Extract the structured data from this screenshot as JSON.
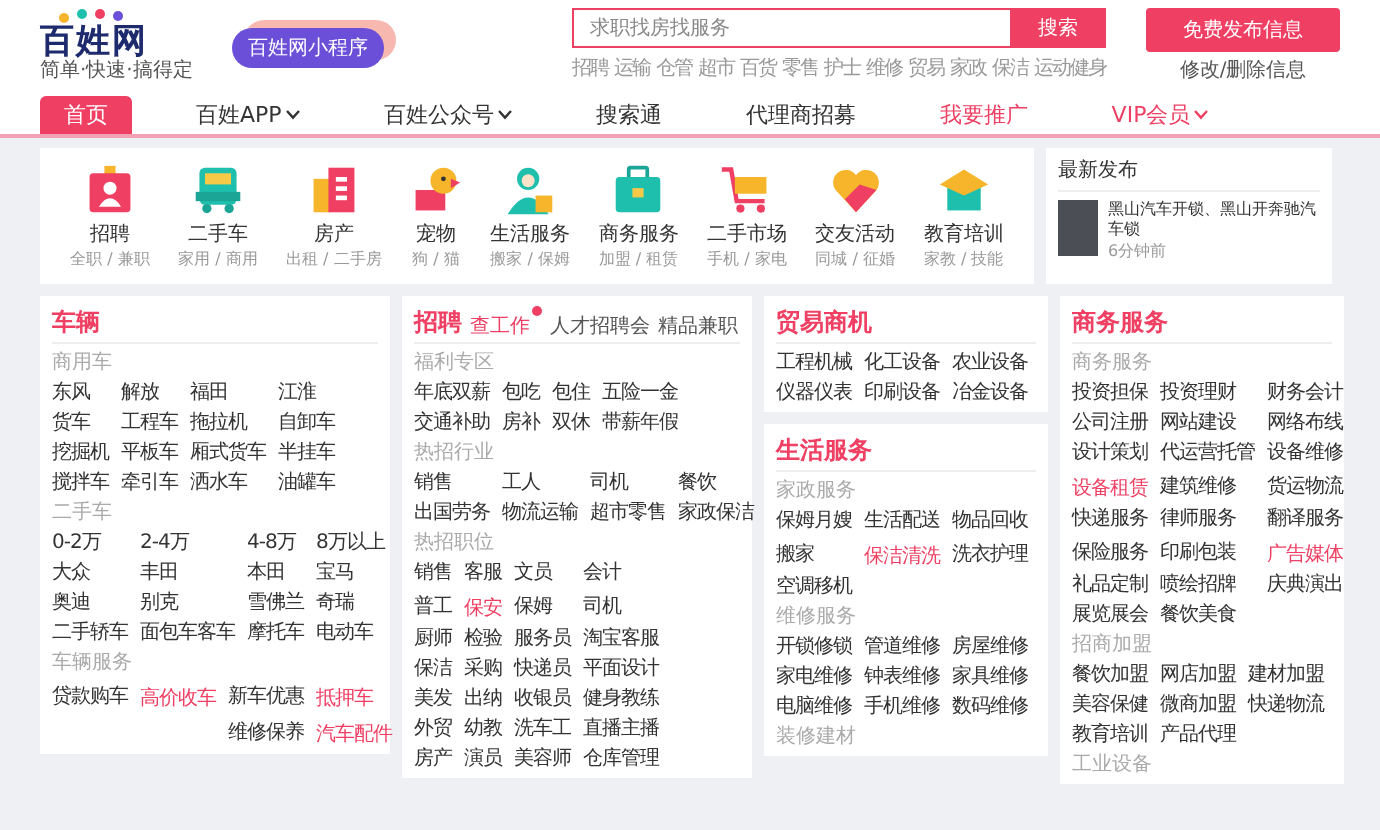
{
  "header": {
    "logo": {
      "name": "百姓网",
      "slogan": "简单·快速·搞得定"
    },
    "mini_program": "百姓网小程序",
    "search": {
      "placeholder": "求职找房找服务",
      "button": "搜索"
    },
    "hot_links": [
      "招聘",
      "运输",
      "仓管",
      "超市",
      "百货",
      "零售",
      "护士",
      "维修",
      "贸易",
      "家政",
      "保洁",
      "运动健身"
    ],
    "publish_button": "免费发布信息",
    "manage_link": "修改/删除信息"
  },
  "nav": [
    {
      "label": "首页",
      "selected": true,
      "dropdown": false,
      "highlight": false
    },
    {
      "label": "百姓APP",
      "selected": false,
      "dropdown": true,
      "highlight": false
    },
    {
      "label": "百姓公众号",
      "selected": false,
      "dropdown": true,
      "highlight": false
    },
    {
      "label": "搜索通",
      "selected": false,
      "dropdown": false,
      "highlight": false
    },
    {
      "label": "代理商招募",
      "selected": false,
      "dropdown": false,
      "highlight": false
    },
    {
      "label": "我要推广",
      "selected": false,
      "dropdown": false,
      "highlight": true
    },
    {
      "label": "VIP会员",
      "selected": false,
      "dropdown": true,
      "highlight": true
    }
  ],
  "categories": [
    {
      "kind": "badge",
      "label": "招聘",
      "sub": "全职 / 兼职"
    },
    {
      "kind": "car",
      "label": "二手车",
      "sub": "家用 / 商用"
    },
    {
      "kind": "building",
      "label": "房产",
      "sub": "出租 / 二手房"
    },
    {
      "kind": "dog",
      "label": "宠物",
      "sub": "狗 / 猫"
    },
    {
      "kind": "person",
      "label": "生活服务",
      "sub": "搬家 / 保姆"
    },
    {
      "kind": "briefcase",
      "label": "商务服务",
      "sub": "加盟 / 租赁"
    },
    {
      "kind": "cart",
      "label": "二手市场",
      "sub": "手机 / 家电"
    },
    {
      "kind": "heart",
      "label": "交友活动",
      "sub": "同城 / 征婚"
    },
    {
      "kind": "cap",
      "label": "教育培训",
      "sub": "家教 / 技能"
    }
  ],
  "latest": {
    "title": "最新发布",
    "items": [
      {
        "text": "黑山汽车开锁、黑山开奔驰汽车锁",
        "time": "6分钟前"
      }
    ]
  },
  "columns": [
    [
      {
        "title": "车辆",
        "sections": [
          {
            "label": "商用车",
            "rows": [
              [
                {
                  "text": "东风",
                  "hot": false
                },
                {
                  "text": "解放",
                  "hot": false
                },
                {
                  "text": "福田",
                  "hot": false
                },
                {
                  "text": "江淮",
                  "hot": false
                }
              ],
              [
                {
                  "text": "货车",
                  "hot": false
                },
                {
                  "text": "工程车",
                  "hot": false
                },
                {
                  "text": "拖拉机",
                  "hot": false
                },
                {
                  "text": "自卸车",
                  "hot": false
                }
              ],
              [
                {
                  "text": "挖掘机",
                  "hot": false
                },
                {
                  "text": "平板车",
                  "hot": false
                },
                {
                  "text": "厢式货车",
                  "hot": false
                },
                {
                  "text": "半挂车",
                  "hot": false
                }
              ],
              [
                {
                  "text": "搅拌车",
                  "hot": false
                },
                {
                  "text": "牵引车",
                  "hot": false
                },
                {
                  "text": "洒水车",
                  "hot": false
                },
                {
                  "text": "油罐车",
                  "hot": false
                }
              ]
            ]
          },
          {
            "label": "二手车",
            "rows": [
              [
                {
                  "text": "0-2万",
                  "hot": false
                },
                {
                  "text": "2-4万",
                  "hot": false
                },
                {
                  "text": "4-8万",
                  "hot": false
                },
                {
                  "text": "8万以上",
                  "hot": false
                }
              ],
              [
                {
                  "text": "大众",
                  "hot": false
                },
                {
                  "text": "丰田",
                  "hot": false
                },
                {
                  "text": "本田",
                  "hot": false
                },
                {
                  "text": "宝马",
                  "hot": false
                }
              ],
              [
                {
                  "text": "奥迪",
                  "hot": false
                },
                {
                  "text": "别克",
                  "hot": false
                },
                {
                  "text": "雪佛兰",
                  "hot": false
                },
                {
                  "text": "奇瑞",
                  "hot": false
                }
              ],
              [
                {
                  "text": "二手轿车",
                  "hot": false
                },
                {
                  "text": "面包车客车",
                  "hot": false
                },
                {
                  "text": "摩托车",
                  "hot": false
                },
                {
                  "text": "电动车",
                  "hot": false
                }
              ]
            ]
          },
          {
            "label": "车辆服务",
            "rows": [
              [
                {
                  "text": "贷款购车",
                  "hot": false
                },
                {
                  "text": "高价收车",
                  "hot": true
                },
                {
                  "text": "新车优惠",
                  "hot": false
                },
                {
                  "text": "抵押车",
                  "hot": true
                }
              ],
              [
                null,
                null,
                {
                  "text": "维修保养",
                  "hot": false
                },
                {
                  "text": "汽车配件",
                  "hot": true
                }
              ]
            ]
          }
        ]
      }
    ],
    [
      {
        "title": "招聘",
        "links": [
          {
            "text": "查工作",
            "highlight": true,
            "badge": true
          },
          {
            "text": "人才招聘会",
            "highlight": false,
            "badge": false
          },
          {
            "text": "精品兼职",
            "highlight": false,
            "badge": false
          }
        ],
        "sections": [
          {
            "label": "福利专区",
            "rows": [
              [
                {
                  "text": "年底双薪",
                  "hot": false
                },
                {
                  "text": "包吃",
                  "hot": false
                },
                {
                  "text": "包住",
                  "hot": false
                },
                {
                  "text": "五险一金",
                  "hot": false
                }
              ],
              [
                {
                  "text": "交通补助",
                  "hot": false
                },
                {
                  "text": "房补",
                  "hot": false
                },
                {
                  "text": "双休",
                  "hot": false
                },
                {
                  "text": "带薪年假",
                  "hot": false
                }
              ]
            ]
          },
          {
            "label": "热招行业",
            "rows": [
              [
                {
                  "text": "销售",
                  "hot": false
                },
                {
                  "text": "工人",
                  "hot": false
                },
                {
                  "text": "司机",
                  "hot": false
                },
                {
                  "text": "餐饮",
                  "hot": false
                }
              ],
              [
                {
                  "text": "出国劳务",
                  "hot": false
                },
                {
                  "text": "物流运输",
                  "hot": false
                },
                {
                  "text": "超市零售",
                  "hot": false
                },
                {
                  "text": "家政保洁",
                  "hot": false
                }
              ]
            ]
          },
          {
            "label": "热招职位",
            "rows": [
              [
                {
                  "text": "销售",
                  "hot": false
                },
                {
                  "text": "客服",
                  "hot": false
                },
                {
                  "text": "文员",
                  "hot": false
                },
                {
                  "text": "会计",
                  "hot": false
                }
              ],
              [
                {
                  "text": "普工",
                  "hot": false
                },
                {
                  "text": "保安",
                  "hot": true
                },
                {
                  "text": "保姆",
                  "hot": false
                },
                {
                  "text": "司机",
                  "hot": false
                }
              ],
              [
                {
                  "text": "厨师",
                  "hot": false
                },
                {
                  "text": "检验",
                  "hot": false
                },
                {
                  "text": "服务员",
                  "hot": false
                },
                {
                  "text": "淘宝客服",
                  "hot": false
                }
              ],
              [
                {
                  "text": "保洁",
                  "hot": false
                },
                {
                  "text": "采购",
                  "hot": false
                },
                {
                  "text": "快递员",
                  "hot": false
                },
                {
                  "text": "平面设计",
                  "hot": false
                }
              ],
              [
                {
                  "text": "美发",
                  "hot": false
                },
                {
                  "text": "出纳",
                  "hot": false
                },
                {
                  "text": "收银员",
                  "hot": false
                },
                {
                  "text": "健身教练",
                  "hot": false
                }
              ],
              [
                {
                  "text": "外贸",
                  "hot": false
                },
                {
                  "text": "幼教",
                  "hot": false
                },
                {
                  "text": "洗车工",
                  "hot": false
                },
                {
                  "text": "直播主播",
                  "hot": false
                }
              ],
              [
                {
                  "text": "房产",
                  "hot": false
                },
                {
                  "text": "演员",
                  "hot": false
                },
                {
                  "text": "美容师",
                  "hot": false
                },
                {
                  "text": "仓库管理",
                  "hot": false
                }
              ]
            ]
          }
        ]
      }
    ],
    [
      {
        "title": "贸易商机",
        "sections": [
          {
            "rows": [
              [
                {
                  "text": "工程机械",
                  "hot": false
                },
                {
                  "text": "化工设备",
                  "hot": false
                },
                {
                  "text": "农业设备",
                  "hot": false
                }
              ],
              [
                {
                  "text": "仪器仪表",
                  "hot": false
                },
                {
                  "text": "印刷设备",
                  "hot": false
                },
                {
                  "text": "冶金设备",
                  "hot": false
                }
              ]
            ]
          }
        ]
      },
      {
        "title": "生活服务",
        "sections": [
          {
            "label": "家政服务",
            "rows": [
              [
                {
                  "text": "保姆月嫂",
                  "hot": false
                },
                {
                  "text": "生活配送",
                  "hot": false
                },
                {
                  "text": "物品回收",
                  "hot": false
                }
              ],
              [
                {
                  "text": "搬家",
                  "hot": false
                },
                {
                  "text": "保洁清洗",
                  "hot": true
                },
                {
                  "text": "洗衣护理",
                  "hot": false
                }
              ],
              [
                {
                  "text": "空调移机",
                  "hot": false
                }
              ]
            ]
          },
          {
            "label": "维修服务",
            "rows": [
              [
                {
                  "text": "开锁修锁",
                  "hot": false
                },
                {
                  "text": "管道维修",
                  "hot": false
                },
                {
                  "text": "房屋维修",
                  "hot": false
                }
              ],
              [
                {
                  "text": "家电维修",
                  "hot": false
                },
                {
                  "text": "钟表维修",
                  "hot": false
                },
                {
                  "text": "家具维修",
                  "hot": false
                }
              ],
              [
                {
                  "text": "电脑维修",
                  "hot": false
                },
                {
                  "text": "手机维修",
                  "hot": false
                },
                {
                  "text": "数码维修",
                  "hot": false
                }
              ]
            ]
          },
          {
            "label": "装修建材"
          }
        ]
      }
    ],
    [
      {
        "title": "商务服务",
        "sections": [
          {
            "label": "商务服务",
            "rows": [
              [
                {
                  "text": "投资担保",
                  "hot": false
                },
                {
                  "text": "投资理财",
                  "hot": false
                },
                {
                  "text": "财务会计",
                  "hot": false
                }
              ],
              [
                {
                  "text": "公司注册",
                  "hot": false
                },
                {
                  "text": "网站建设",
                  "hot": false
                },
                {
                  "text": "网络布线",
                  "hot": false
                }
              ],
              [
                {
                  "text": "设计策划",
                  "hot": false
                },
                {
                  "text": "代运营托管",
                  "hot": false
                },
                {
                  "text": "设备维修",
                  "hot": false
                }
              ],
              [
                {
                  "text": "设备租赁",
                  "hot": true
                },
                {
                  "text": "建筑维修",
                  "hot": false
                },
                {
                  "text": "货运物流",
                  "hot": false
                }
              ],
              [
                {
                  "text": "快递服务",
                  "hot": false
                },
                {
                  "text": "律师服务",
                  "hot": false
                },
                {
                  "text": "翻译服务",
                  "hot": false
                }
              ],
              [
                {
                  "text": "保险服务",
                  "hot": false
                },
                {
                  "text": "印刷包装",
                  "hot": false
                },
                {
                  "text": "广告媒体",
                  "hot": true
                }
              ],
              [
                {
                  "text": "礼品定制",
                  "hot": false
                },
                {
                  "text": "喷绘招牌",
                  "hot": false
                },
                {
                  "text": "庆典演出",
                  "hot": false
                }
              ],
              [
                {
                  "text": "展览展会",
                  "hot": false
                },
                {
                  "text": "餐饮美食",
                  "hot": false
                }
              ]
            ]
          },
          {
            "label": "招商加盟",
            "rows": [
              [
                {
                  "text": "餐饮加盟",
                  "hot": false
                },
                {
                  "text": "网店加盟",
                  "hot": false
                },
                {
                  "text": "建材加盟",
                  "hot": false
                }
              ],
              [
                {
                  "text": "美容保健",
                  "hot": false
                },
                {
                  "text": "微商加盟",
                  "hot": false
                },
                {
                  "text": "快递物流",
                  "hot": false
                }
              ],
              [
                {
                  "text": "教育培训",
                  "hot": false
                },
                {
                  "text": "产品代理",
                  "hot": false
                }
              ]
            ]
          },
          {
            "label": "工业设备"
          }
        ]
      }
    ]
  ]
}
